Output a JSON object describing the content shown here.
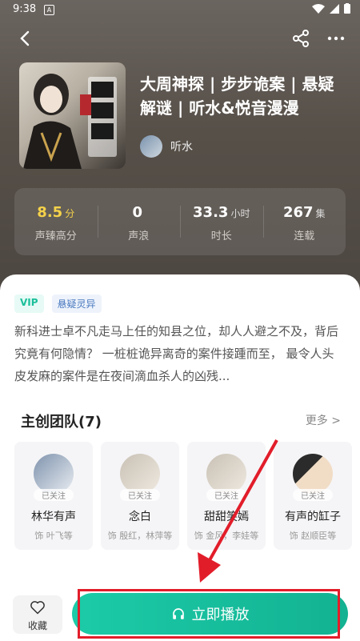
{
  "status_bar": {
    "time": "9:38",
    "notif_icon": "A"
  },
  "header": {
    "back_icon": "back-arrow-icon",
    "share_icon": "share-icon",
    "more_icon": "more-icon"
  },
  "album": {
    "title": "大周神探 | 步步诡案 | 悬疑解谜 | 听水&悦音漫漫",
    "author": "听水"
  },
  "stats": [
    {
      "value": "8.5",
      "unit": "分",
      "label": "声臻高分",
      "highlight": true
    },
    {
      "value": "0",
      "unit": "",
      "label": "声浪",
      "highlight": false
    },
    {
      "value": "33.3",
      "unit": "小时",
      "label": "时长",
      "highlight": false
    },
    {
      "value": "267",
      "unit": "集",
      "label": "连载",
      "highlight": false
    }
  ],
  "tags": {
    "vip": "VIP",
    "genre": "悬疑灵异"
  },
  "description": "新科进士卓不凡走马上任的知县之位，却人人避之不及，背后究竟有何隐情？ 一桩桩诡异离奇的案件接踵而至， 最令人头皮发麻的案件是在夜间滴血杀人的凶残...",
  "team": {
    "heading": "主创团队(7)",
    "more": "更多 >",
    "members": [
      {
        "name": "林华有声",
        "role": "饰 叶飞等",
        "followed": "已关注"
      },
      {
        "name": "念白",
        "role": "饰 殷红，林萍等",
        "followed": "已关注"
      },
      {
        "name": "甜甜笑嫣",
        "role": "饰 金风，李娃等",
        "followed": "已关注"
      },
      {
        "name": "有声的缸子",
        "role": "饰 赵顺臣等",
        "followed": "已关注"
      }
    ]
  },
  "bottom": {
    "favorite": "收藏",
    "play": "立即播放"
  },
  "colors": {
    "accent": "#1ccba8",
    "annotation": "#e21d2a"
  }
}
